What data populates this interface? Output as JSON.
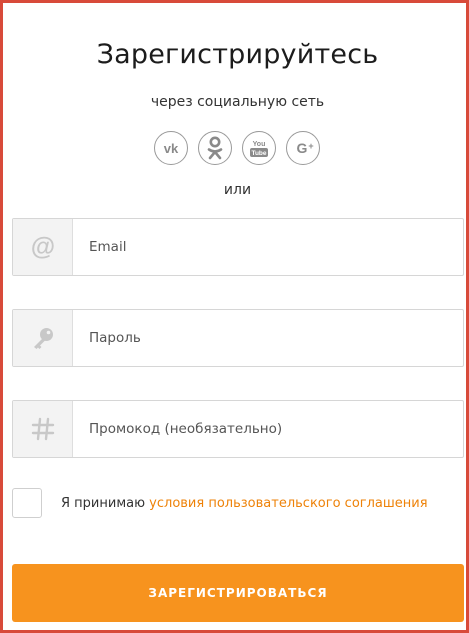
{
  "heading": "Зарегистрируйтесь",
  "subheading": "через социальную сеть",
  "social": {
    "vk": "vk-icon",
    "ok": "odnoklassniki-icon",
    "youtube": "youtube-icon",
    "youtube_text": "You Tube",
    "google": "google-plus-icon",
    "google_text": "G+"
  },
  "separator": "или",
  "form": {
    "email_placeholder": "Email",
    "password_placeholder": "Пароль",
    "promo_placeholder": "Промокод (необязательно)"
  },
  "agreement": {
    "text": "Я принимаю ",
    "link": "условия пользовательского соглашения",
    "checked": false
  },
  "submit_label": "ЗАРЕГИСТРИРОВАТЬСЯ",
  "colors": {
    "accent": "#f7931e",
    "link": "#ee8208",
    "border": "#d84a3a"
  }
}
